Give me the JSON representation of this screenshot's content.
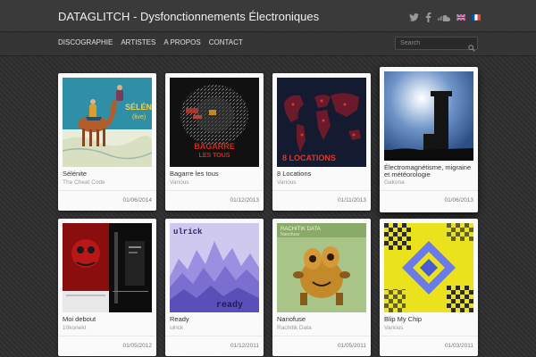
{
  "header": {
    "site_title": "DATAGLITCH - Dysfonctionnements Électroniques"
  },
  "social": [
    "twitter-icon",
    "facebook-icon",
    "soundcloud-icon",
    "flag-uk-icon",
    "flag-fr-icon"
  ],
  "nav": [
    {
      "label": "Discographie"
    },
    {
      "label": "Artistes"
    },
    {
      "label": "A propos"
    },
    {
      "label": "Contact"
    }
  ],
  "search": {
    "placeholder": "Search"
  },
  "albums": [
    {
      "title": "Sélénite",
      "artist": "The Cheat Code",
      "date": "01/06/2014",
      "cover_text": "SÉLÉNITE",
      "cover_sub": "(live)"
    },
    {
      "title": "Bagarre les tous",
      "artist": "Various",
      "date": "01/12/2013",
      "cover_text": "BAGARRE",
      "cover_sub": "LES TOUS"
    },
    {
      "title": "8 Locations",
      "artist": "Various",
      "date": "01/11/2013",
      "cover_text": "8 LOCATIONS"
    },
    {
      "title": "Électromagnétisme, migraine et météorologie",
      "artist": "Gakona",
      "date": "01/06/2013"
    },
    {
      "title": "Moi debout",
      "artist": "10konekt",
      "date": "01/05/2012"
    },
    {
      "title": "Ready",
      "artist": "ulrick",
      "date": "01/12/2011",
      "cover_text": "ulrick",
      "cover_sub": "ready"
    },
    {
      "title": "Nanofuse",
      "artist": "Rachitik Data",
      "date": "01/05/2011",
      "cover_text": "RACHITIK DATA",
      "cover_sub": "Nanofuse"
    },
    {
      "title": "Blip My Chip",
      "artist": "Various",
      "date": "01/03/2011"
    }
  ],
  "colors": {
    "accent_orange": "#e25a3a",
    "map_red": "#d83a2a",
    "page_bg": "#2f2f2f"
  }
}
